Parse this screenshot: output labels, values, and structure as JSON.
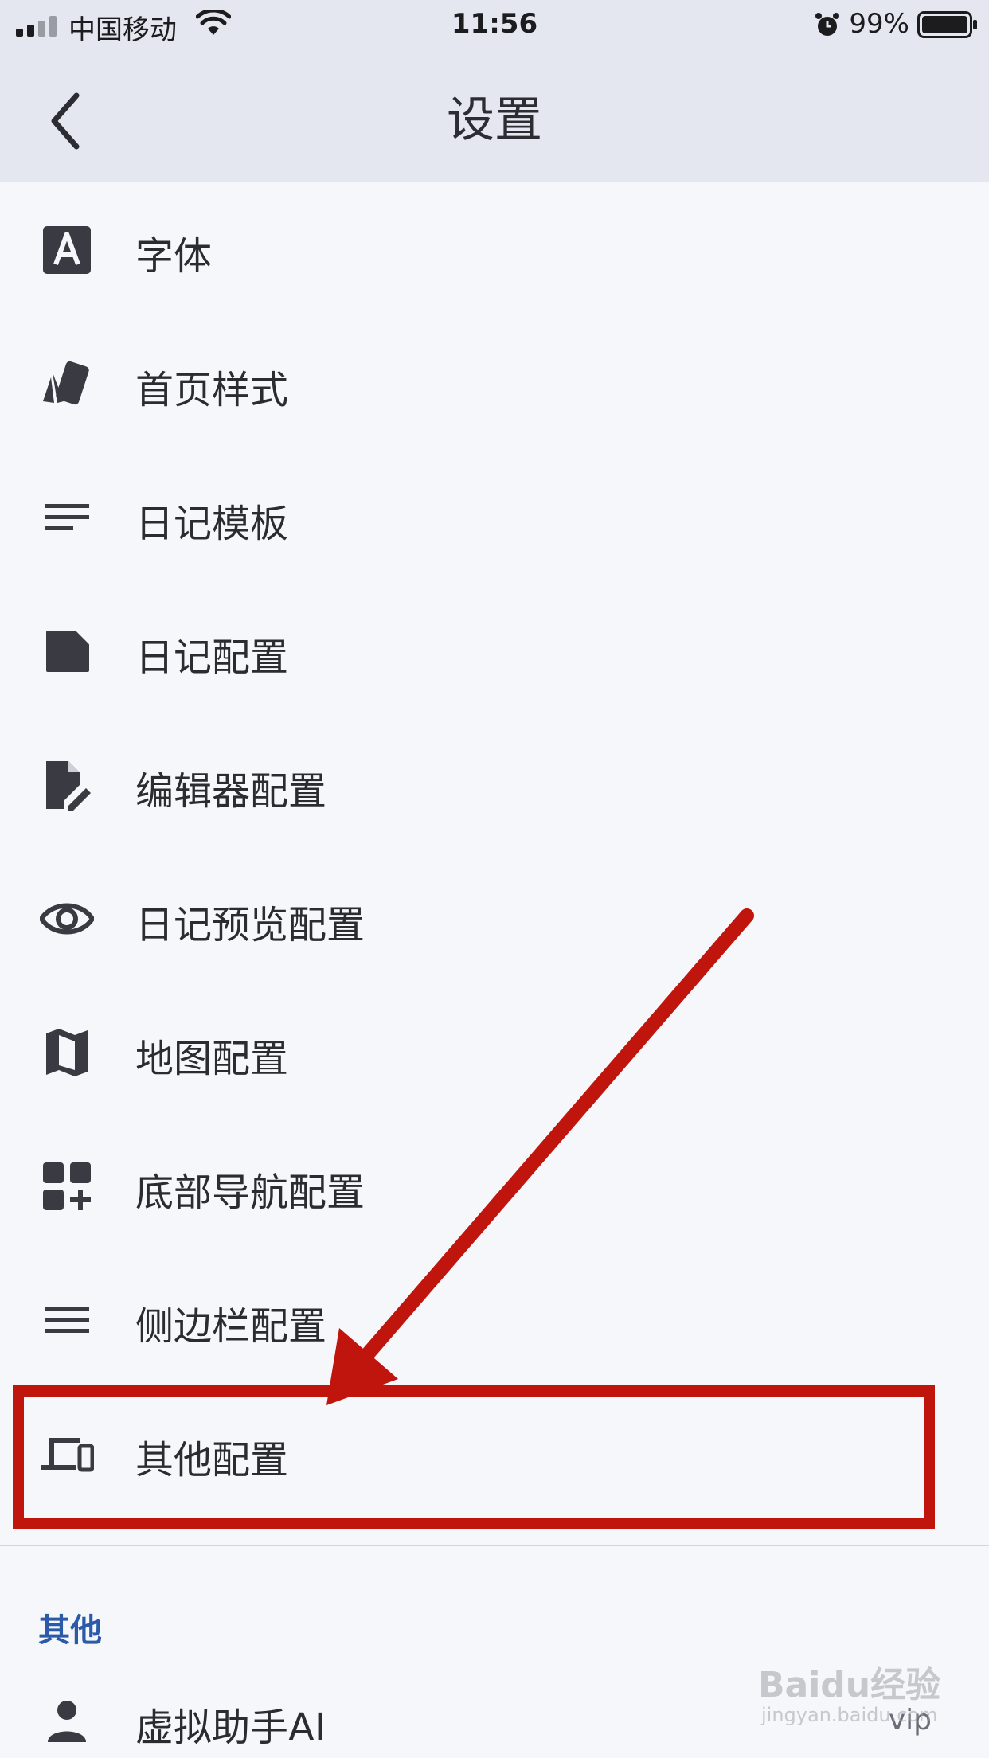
{
  "status_bar": {
    "carrier": "中国移动",
    "time": "11:56",
    "battery_pct": "99%"
  },
  "nav": {
    "title": "设置"
  },
  "menu_items": [
    {
      "label": "字体",
      "icon": "font-icon"
    },
    {
      "label": "首页样式",
      "icon": "style-cards-icon"
    },
    {
      "label": "日记模板",
      "icon": "lines-icon"
    },
    {
      "label": "日记配置",
      "icon": "note-icon"
    },
    {
      "label": "编辑器配置",
      "icon": "edit-file-icon"
    },
    {
      "label": "日记预览配置",
      "icon": "eye-icon"
    },
    {
      "label": "地图配置",
      "icon": "map-icon"
    },
    {
      "label": "底部导航配置",
      "icon": "grid-add-icon"
    },
    {
      "label": "侧边栏配置",
      "icon": "menu-icon"
    },
    {
      "label": "其他配置",
      "icon": "devices-icon"
    }
  ],
  "other_section": {
    "title": "其他",
    "items": [
      {
        "label": "虚拟助手AI",
        "badge": "vip",
        "icon": "person-icon"
      }
    ]
  },
  "watermark": {
    "text": "Baidu经验",
    "sub": "jingyan.baidu.com"
  },
  "colors": {
    "highlight": "#c0150d",
    "section_title": "#2b5aa8",
    "header_bg": "#e4e7ef"
  }
}
